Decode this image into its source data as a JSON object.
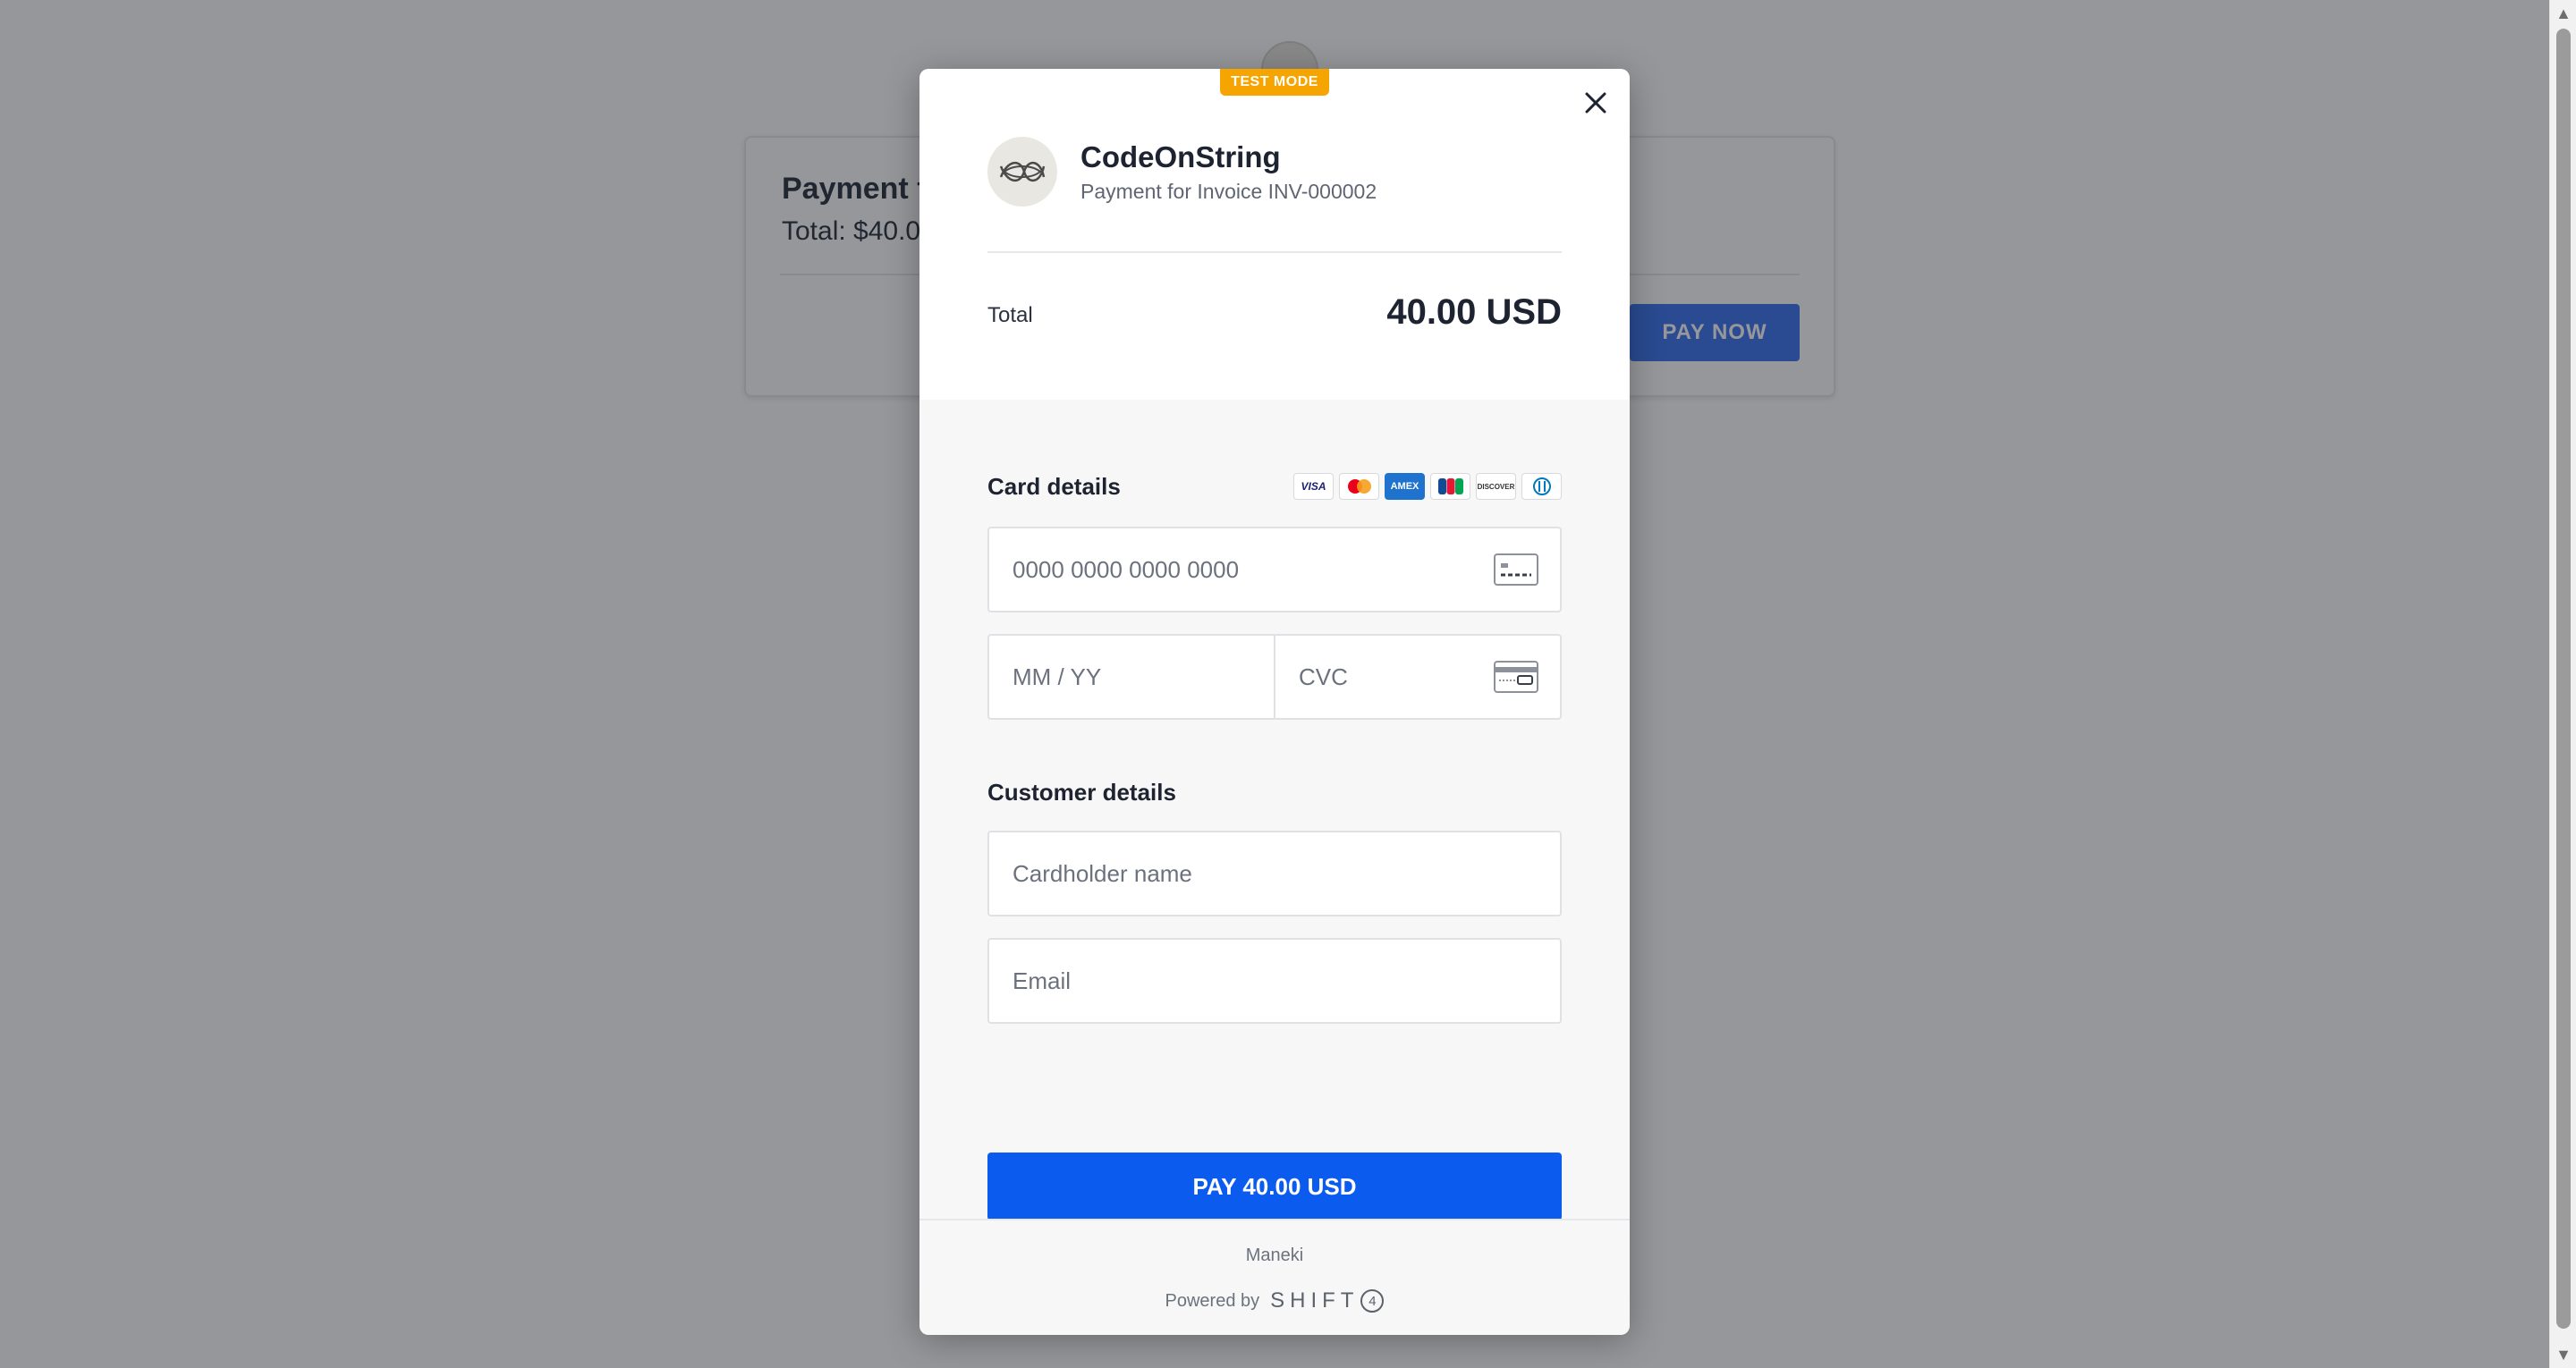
{
  "background_page": {
    "card_title": "Payment f",
    "card_total": "Total: $40.0",
    "pay_now_label": "PAY NOW"
  },
  "modal": {
    "test_mode_label": "TEST MODE",
    "merchant_name": "CodeOnString",
    "merchant_description": "Payment for Invoice INV-000002",
    "total_label": "Total",
    "total_amount": "40.00 USD",
    "card_details_title": "Card details",
    "card_brands": [
      "VISA",
      "mastercard",
      "AMEX",
      "JCB",
      "DISCOVER",
      "diners"
    ],
    "card_number_placeholder": "0000 0000 0000 0000",
    "expiry_placeholder": "MM / YY",
    "cvc_placeholder": "CVC",
    "customer_details_title": "Customer details",
    "cardholder_placeholder": "Cardholder name",
    "email_placeholder": "Email",
    "pay_button_label": "PAY 40.00 USD",
    "footer_merchant": "Maneki",
    "powered_by_label": "Powered by",
    "shift4_text": "SHIFT",
    "shift4_digit": "4"
  },
  "colors": {
    "accent": "#0c5bef",
    "test_mode_badge": "#f5a400",
    "background_pay_now": "#3b76f0"
  }
}
